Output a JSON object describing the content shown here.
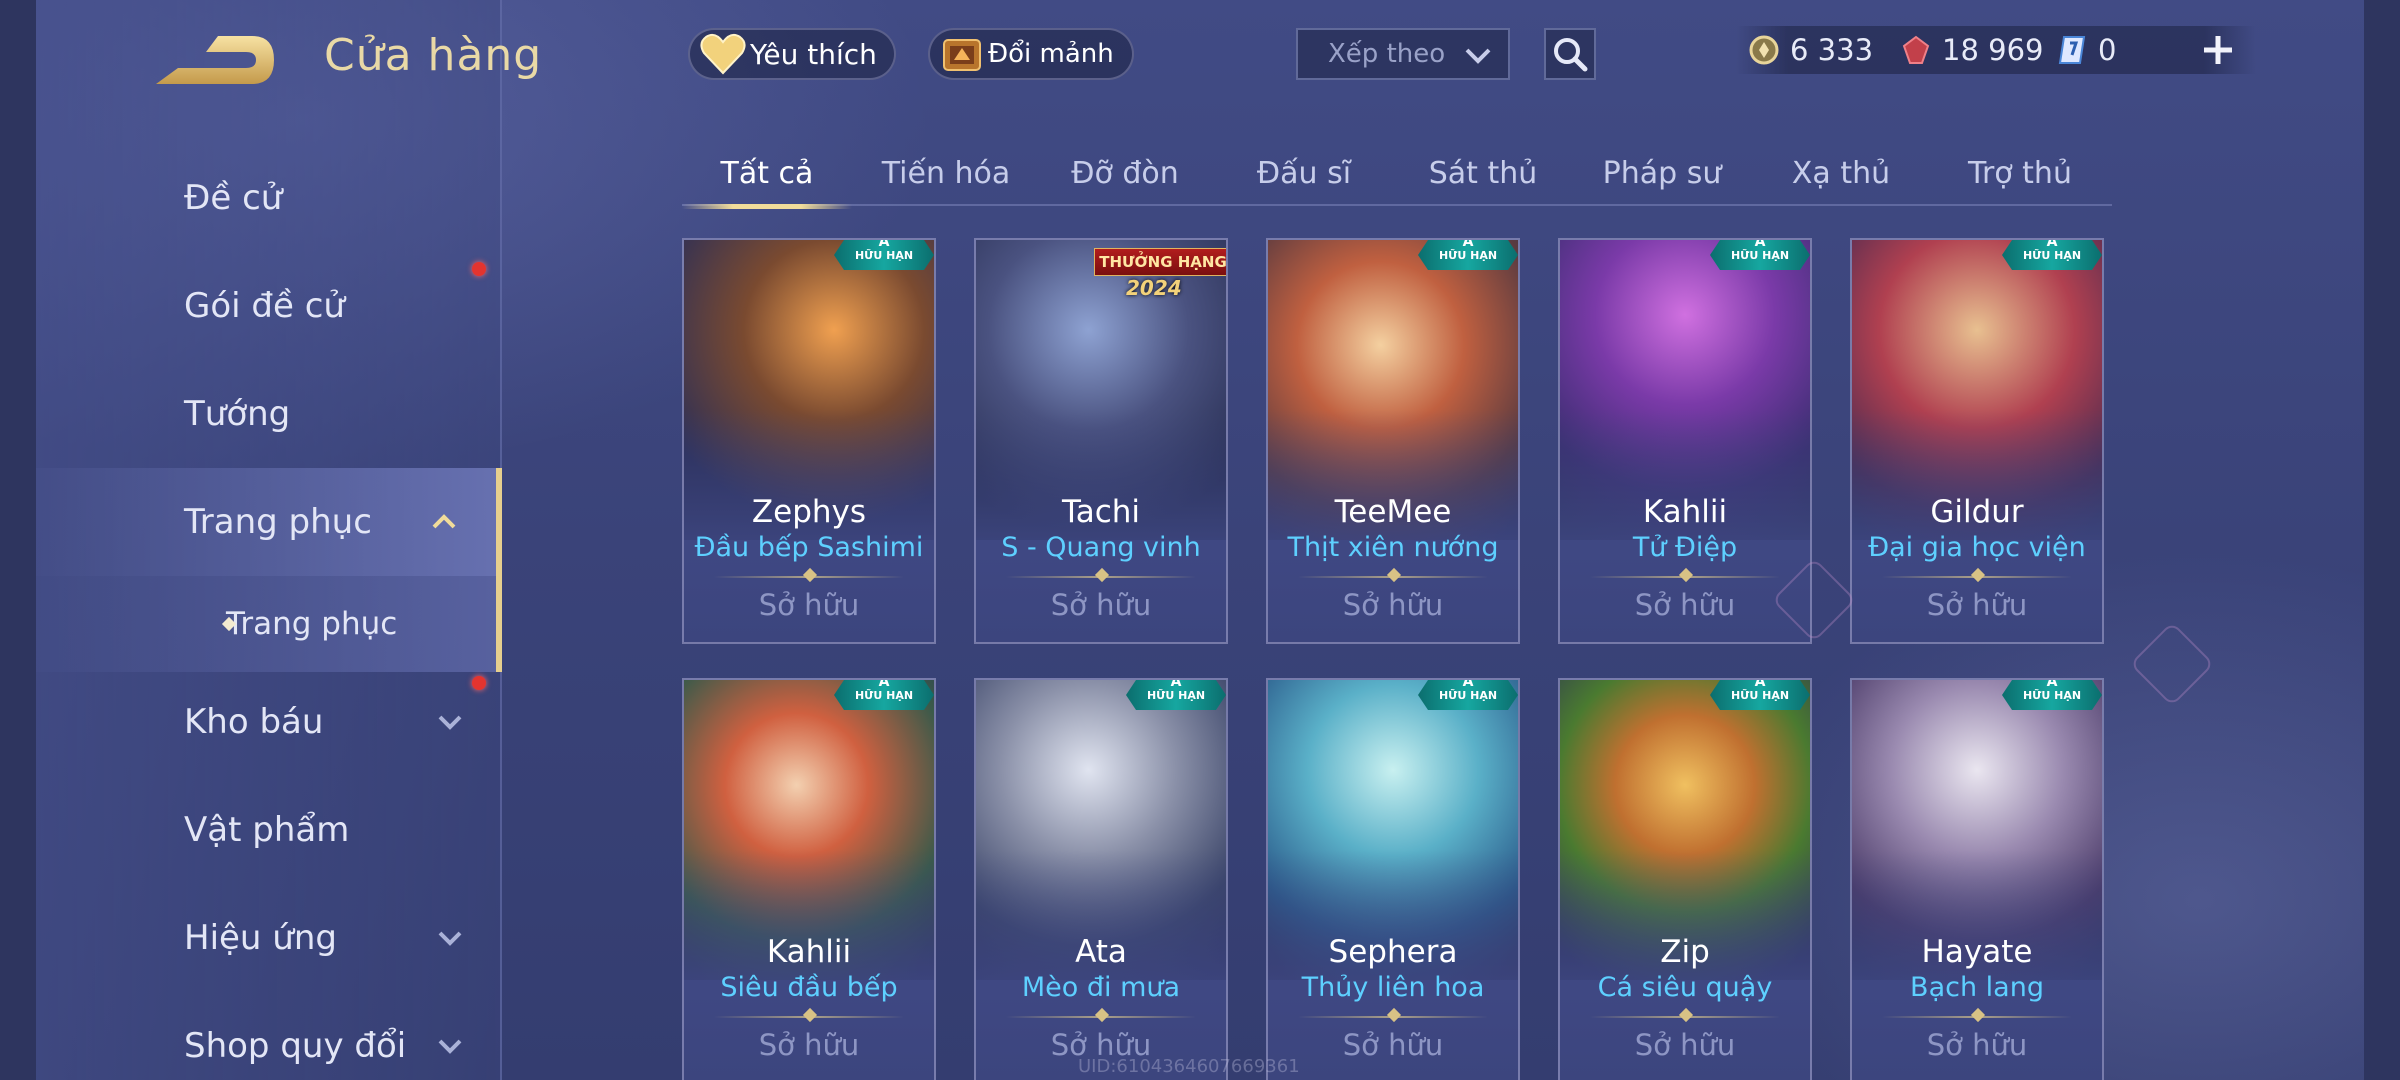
{
  "header": {
    "title": "Cửa hàng",
    "favorites_label": "Yêu thích",
    "exchange_label": "Đổi mảnh",
    "sort_label": "Xếp theo"
  },
  "currencies": [
    {
      "name": "vang",
      "icon": "coin-icon",
      "value": "6 333"
    },
    {
      "name": "quan-huy",
      "icon": "ruby-icon",
      "value": "18 969"
    },
    {
      "name": "mam-xanh",
      "icon": "ticket-icon",
      "value": "0"
    }
  ],
  "sidebar": {
    "items": [
      {
        "label": "Đề cử"
      },
      {
        "label": "Gói đề cử"
      },
      {
        "label": "Tướng"
      },
      {
        "label": "Trang phục"
      },
      {
        "label": "Trang phục"
      },
      {
        "label": "Kho báu"
      },
      {
        "label": "Vật phẩm"
      },
      {
        "label": "Hiệu ứng"
      },
      {
        "label": "Shop quy đổi"
      }
    ]
  },
  "tabs": [
    {
      "label": "Tất cả"
    },
    {
      "label": "Tiến hóa"
    },
    {
      "label": "Đỡ đòn"
    },
    {
      "label": "Đấu sĩ"
    },
    {
      "label": "Sát thủ"
    },
    {
      "label": "Pháp sư"
    },
    {
      "label": "Xạ thủ"
    },
    {
      "label": "Trợ thủ"
    }
  ],
  "cards": [
    {
      "hero": "Zephys",
      "skin": "Đầu bếp Sashimi",
      "status": "Sở hữu",
      "badge": "HỮU HẠN",
      "tier": "A"
    },
    {
      "hero": "Tachi",
      "skin": "S - Quang vinh",
      "status": "Sở hữu",
      "event": "THƯỞNG HẠNG",
      "event_year": "2024"
    },
    {
      "hero": "TeeMee",
      "skin": "Thịt xiên nướng",
      "status": "Sở hữu",
      "badge": "HỮU HẠN",
      "tier": "A"
    },
    {
      "hero": "Kahlii",
      "skin": "Tử Điệp",
      "status": "Sở hữu",
      "badge": "HỮU HẠN",
      "tier": "A"
    },
    {
      "hero": "Gildur",
      "skin": "Đại gia học viện",
      "status": "Sở hữu",
      "badge": "HỮU HẠN",
      "tier": "A"
    },
    {
      "hero": "Kahlii",
      "skin": "Siêu đầu bếp",
      "status": "Sở hữu",
      "badge": "HỮU HẠN",
      "tier": "A"
    },
    {
      "hero": "Ata",
      "skin": "Mèo đi mưa",
      "status": "Sở hữu",
      "badge": "HỮU HẠN",
      "tier": "A"
    },
    {
      "hero": "Sephera",
      "skin": "Thủy liên hoa",
      "status": "Sở hữu",
      "badge": "HỮU HẠN",
      "tier": "A"
    },
    {
      "hero": "Zip",
      "skin": "Cá siêu quậy",
      "status": "Sở hữu",
      "badge": "HỮU HẠN",
      "tier": "A"
    },
    {
      "hero": "Hayate",
      "skin": "Bạch lang",
      "status": "Sở hữu",
      "badge": "HỮU HẠN",
      "tier": "A"
    }
  ],
  "watermark": "UID:6104364607669361",
  "colors": {
    "accent_gold": "#e6cf8e",
    "skin_name": "#5ed0ff",
    "badge_teal": "#16a7a0",
    "notification_red": "#e3342f"
  }
}
